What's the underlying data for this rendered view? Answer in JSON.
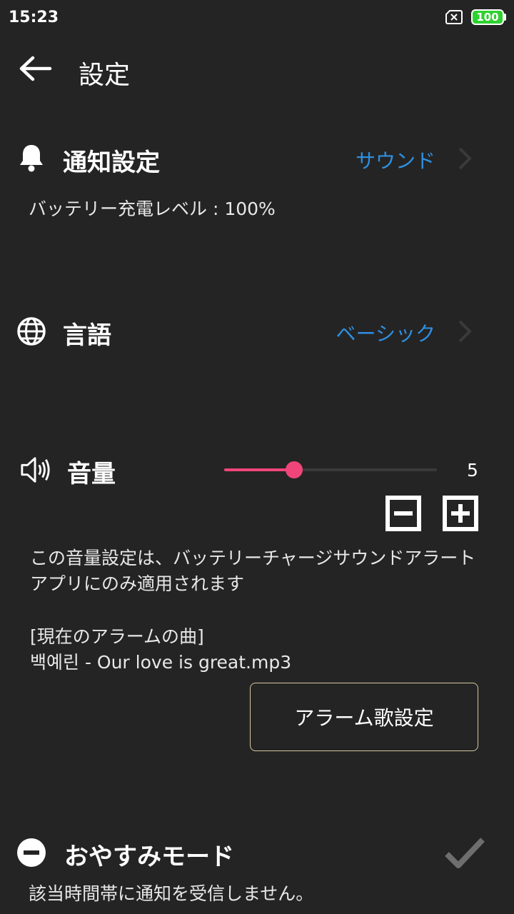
{
  "status_bar": {
    "time": "15:23",
    "battery_level": "100",
    "sim_icon": "sim-card-x-icon",
    "colors": {
      "battery": "#2fd12f"
    }
  },
  "header": {
    "title": "設定",
    "back_icon": "arrow-left-icon"
  },
  "notification": {
    "title": "通知設定",
    "value": "サウンド",
    "detail": "バッテリー充電レベル : 100%",
    "icon": "bell-icon"
  },
  "language": {
    "title": "言語",
    "value": "ベーシック",
    "icon": "globe-icon"
  },
  "volume": {
    "title": "音量",
    "level": 5,
    "fill_fraction": 0.33,
    "value_label": "5",
    "description": "この音量設定は、バッテリーチャージサウンドアラートアプリにのみ適用されます",
    "current_song_label": "[現在のアラームの曲]",
    "current_song": "백예린 - Our love is great.mp3",
    "set_button": "アラーム歌設定",
    "icon": "speaker-icon",
    "colors": {
      "slider": "#f0457a"
    }
  },
  "sleep_mode": {
    "title": "おやすみモード",
    "detail": "該当時間帯に通知を受信しません。",
    "icon": "minus-circle-icon",
    "check_icon": "checkmark-icon"
  },
  "colors": {
    "background": "#242424",
    "accent_link": "#2e8fe0",
    "button_border": "#d8c7a0"
  }
}
